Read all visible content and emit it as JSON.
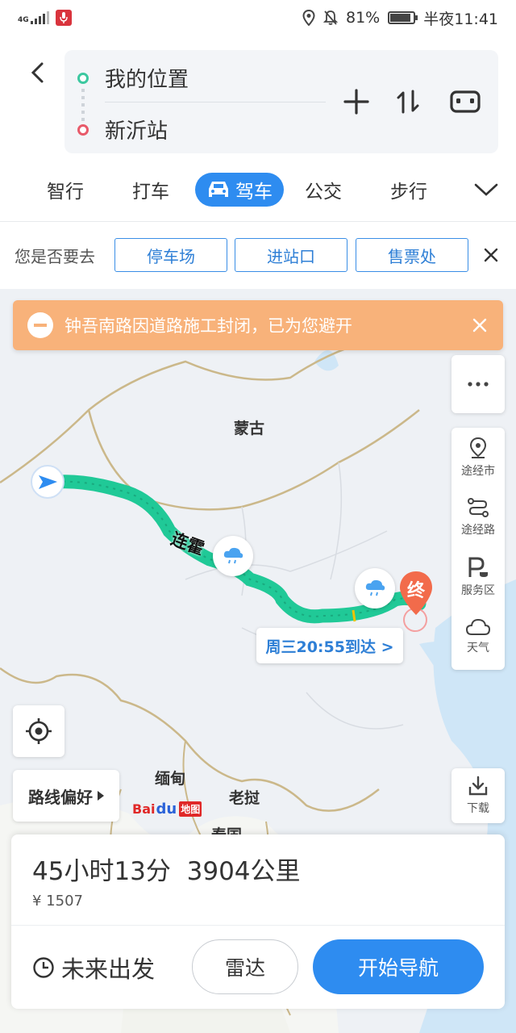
{
  "status_bar": {
    "network": "4G",
    "battery": "81%",
    "battery_level": 0.81,
    "time": "半夜11:41"
  },
  "route": {
    "from": "我的位置",
    "to": "新沂站"
  },
  "tabs": [
    {
      "label": "智行",
      "active": false
    },
    {
      "label": "打车",
      "active": false
    },
    {
      "label": "驾车",
      "active": true
    },
    {
      "label": "公交",
      "active": false
    },
    {
      "label": "步行",
      "active": false
    }
  ],
  "suggest": {
    "question": "您是否要去",
    "chips": [
      "停车场",
      "进站口",
      "售票处"
    ]
  },
  "notice": {
    "text": "钟吾南路因道路施工封闭，已为您避开"
  },
  "map": {
    "labels": {
      "mongolia": "蒙古",
      "myanmar": "缅甸",
      "laos": "老挝",
      "thailand": "泰国",
      "road": "连霍",
      "end_marker": "终"
    },
    "route_color": "#20c997",
    "logo": {
      "bai": "Bai",
      "du": "du",
      "ditu": "地图"
    }
  },
  "side_tools": [
    {
      "label": "途经市",
      "icon": "city-pin-icon"
    },
    {
      "label": "途经路",
      "icon": "route-icon"
    },
    {
      "label": "服务区",
      "icon": "service-area-icon"
    },
    {
      "label": "天气",
      "icon": "cloud-icon"
    }
  ],
  "download_label": "下载",
  "arrival": "周三20:55到达 >",
  "route_pref": "路线偏好",
  "summary": {
    "duration": "45小时13分",
    "distance": "3904公里",
    "cost": "¥ 1507"
  },
  "bottom": {
    "future": "未来出发",
    "radar": "雷达",
    "start_nav": "开始导航"
  }
}
